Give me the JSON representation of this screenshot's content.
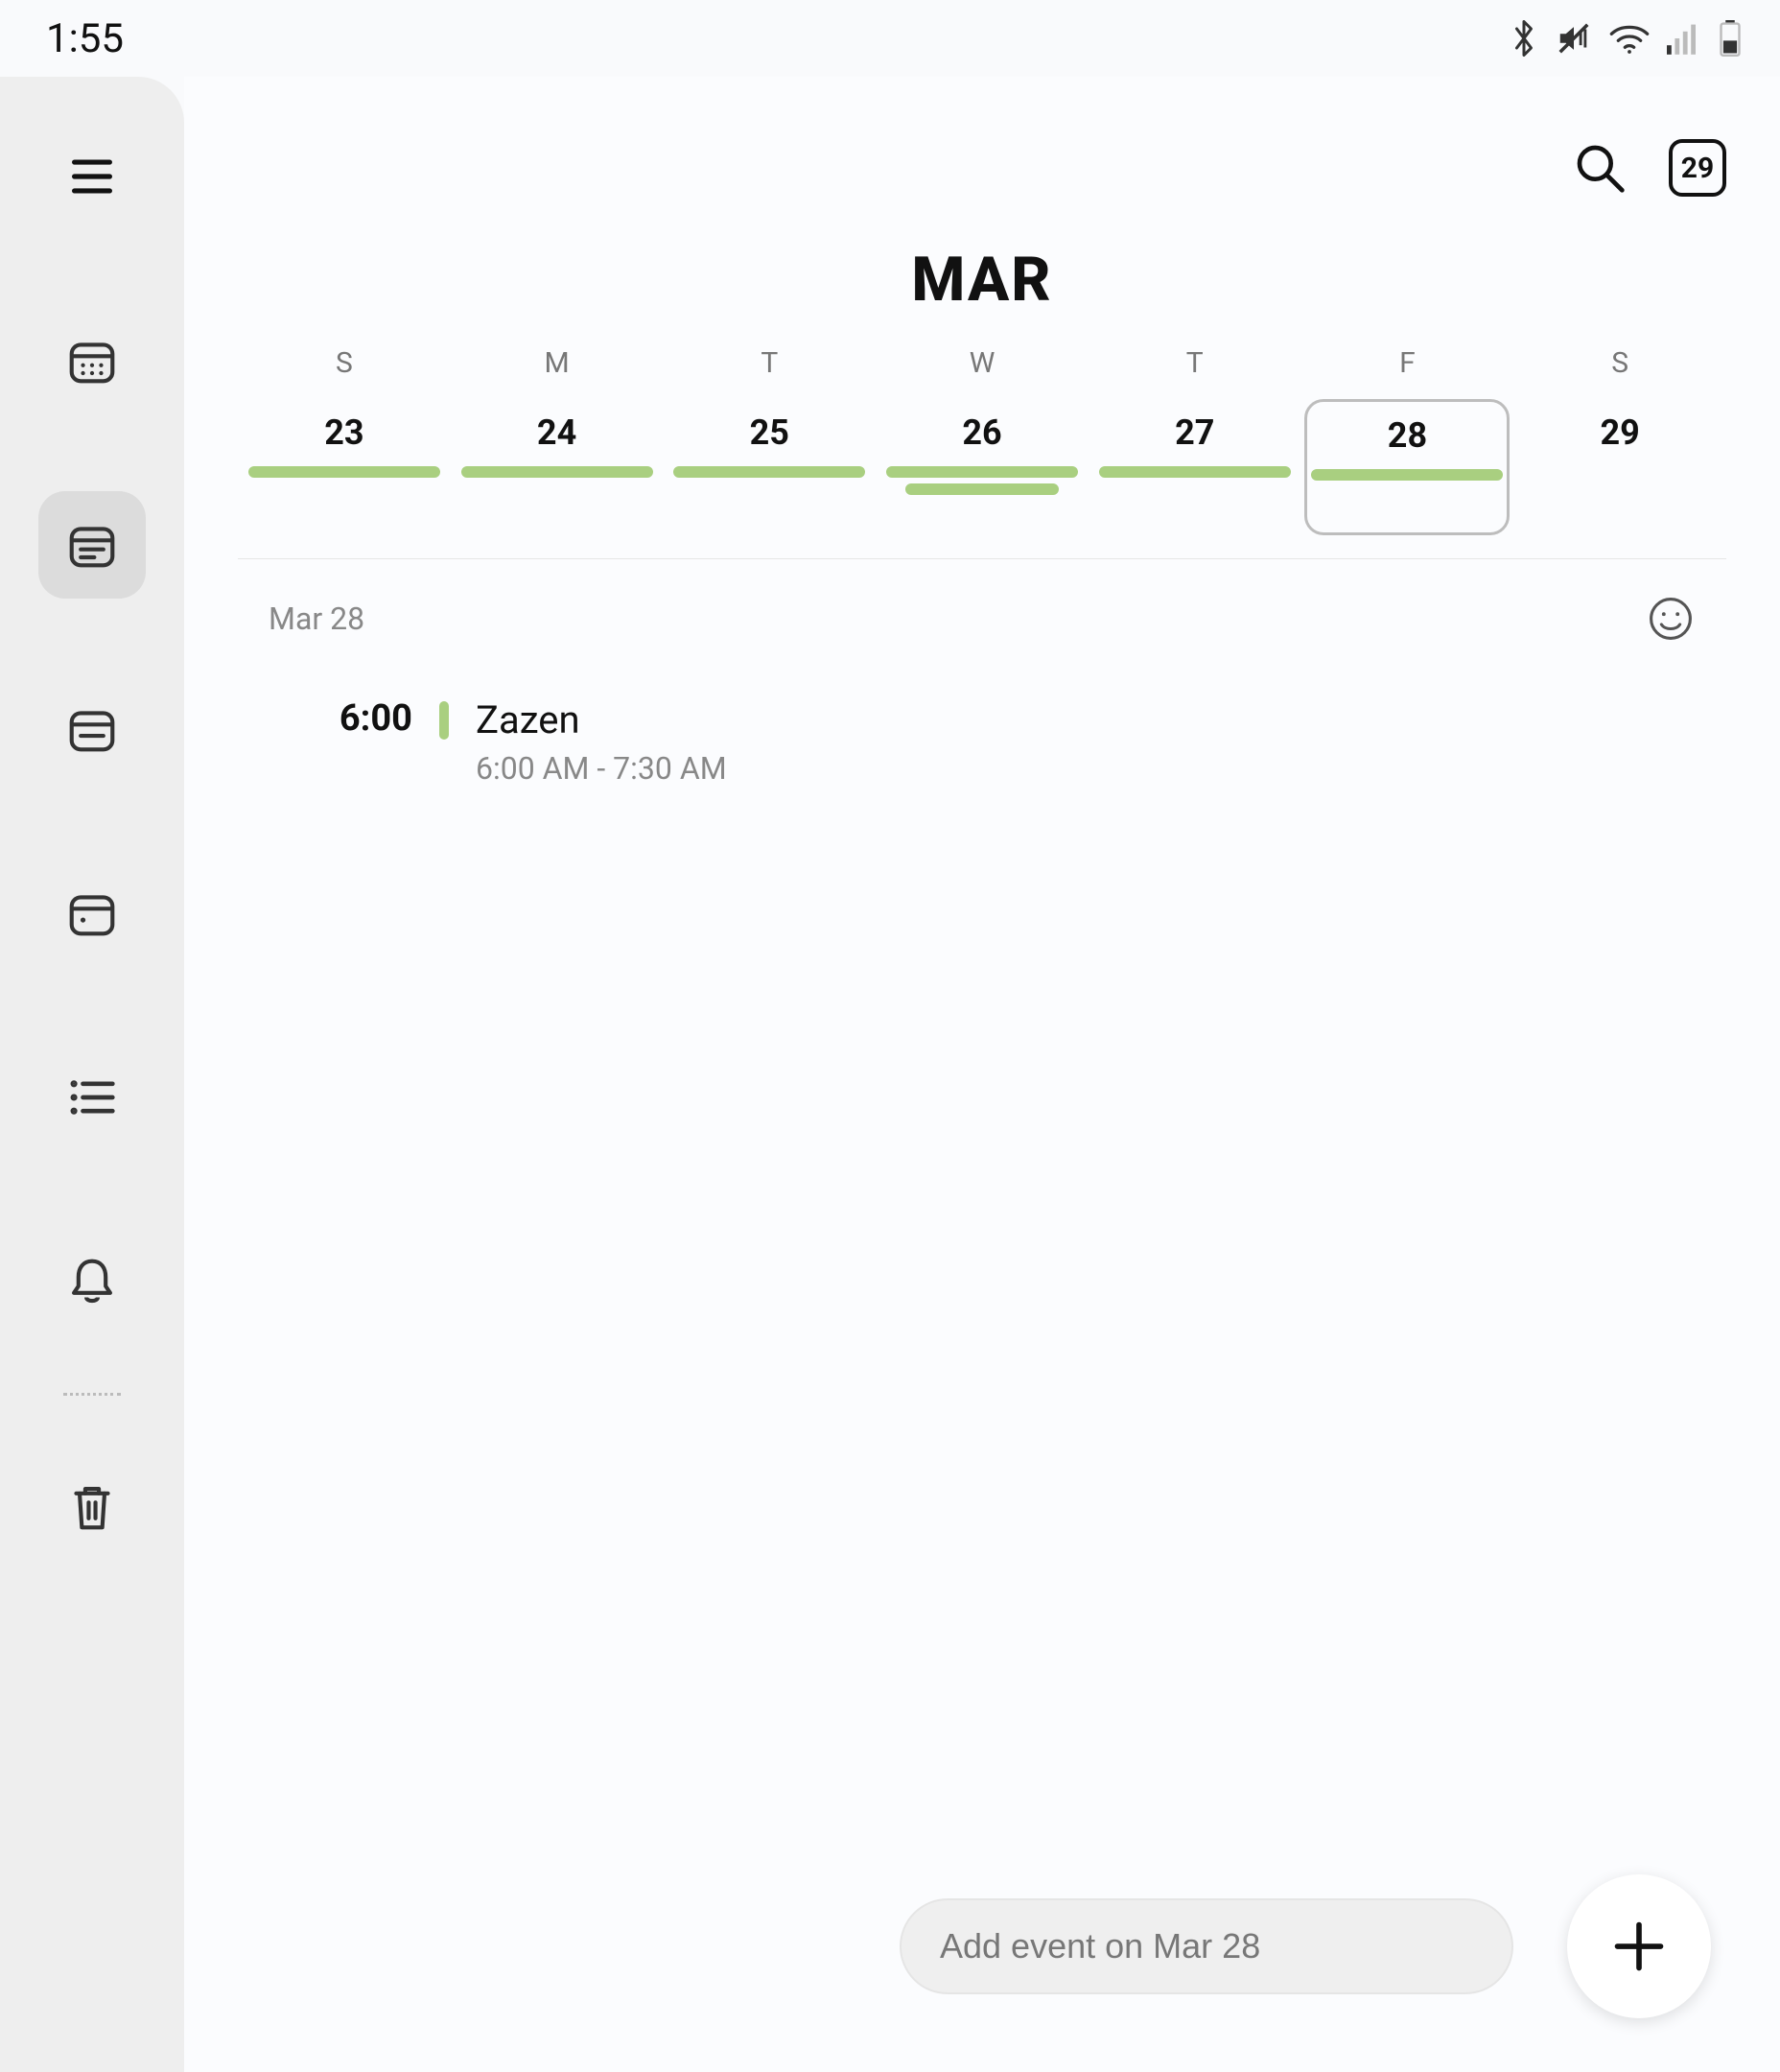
{
  "status": {
    "time": "1:55"
  },
  "toolbar": {
    "today_chip": "29"
  },
  "month_heading": "MAR",
  "week": [
    {
      "name": "S",
      "num": "23",
      "bars": [
        200
      ],
      "selected": false
    },
    {
      "name": "M",
      "num": "24",
      "bars": [
        200
      ],
      "selected": false
    },
    {
      "name": "T",
      "num": "25",
      "bars": [
        200
      ],
      "selected": false
    },
    {
      "name": "W",
      "num": "26",
      "bars": [
        200,
        160
      ],
      "selected": false
    },
    {
      "name": "T",
      "num": "27",
      "bars": [
        200
      ],
      "selected": false
    },
    {
      "name": "F",
      "num": "28",
      "bars": [
        200
      ],
      "selected": true
    },
    {
      "name": "S",
      "num": "29",
      "bars": [],
      "selected": false
    }
  ],
  "day_header": {
    "label": "Mar 28"
  },
  "event": {
    "time": "6:00",
    "title": "Zazen",
    "subtitle": "6:00 AM - 7:30 AM",
    "color": "#a9cf80"
  },
  "add_input": {
    "placeholder": "Add event on Mar 28"
  }
}
